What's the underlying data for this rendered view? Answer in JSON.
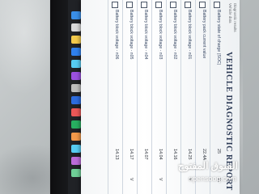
{
  "report": {
    "title": "VEHICLE DIAGNOSTIC REPORT",
    "header_lines": [
      "Diagnostic results",
      "Vehicle data"
    ]
  },
  "rows": [
    {
      "label": "Battery state of charge (SOC)",
      "value": "25",
      "unit": "%"
    },
    {
      "label": "Battery pack current value",
      "value": "22.4A",
      "unit": ""
    },
    {
      "label": "Battery block voltage - n01",
      "value": "14.25",
      "unit": "V"
    },
    {
      "label": "Battery block voltage - n02",
      "value": "14.16",
      "unit": ""
    },
    {
      "label": "Battery block voltage - n03",
      "value": "14.04",
      "unit": "V"
    },
    {
      "label": "Battery block voltage - n04",
      "value": "14.07",
      "unit": ""
    },
    {
      "label": "Battery block voltage - n05",
      "value": "14.17",
      "unit": "V"
    },
    {
      "label": "Battery block voltage - n06",
      "value": "14.13",
      "unit": ""
    }
  ],
  "taskbar": {
    "icons": [
      "start-icon",
      "search-icon",
      "file-explorer-icon",
      "browser-icon",
      "mail-icon",
      "store-icon",
      "settings-icon",
      "word-icon",
      "pdf-icon",
      "photos-icon",
      "media-icon",
      "app-icon",
      "app-icon",
      "app-icon"
    ],
    "colors": [
      "#3a8ee6",
      "#d9d9d9",
      "#f2c94c",
      "#2f80ed",
      "#56ccf2",
      "#9b51e0",
      "#bdbdbd",
      "#2d6cdf",
      "#eb5757",
      "#27ae60",
      "#f2994a",
      "#56ccf2",
      "#bb6bd9",
      "#6fcf97"
    ]
  },
  "watermark": {
    "arabic": "السوق المفتوح",
    "latin": "opensooq.com"
  }
}
